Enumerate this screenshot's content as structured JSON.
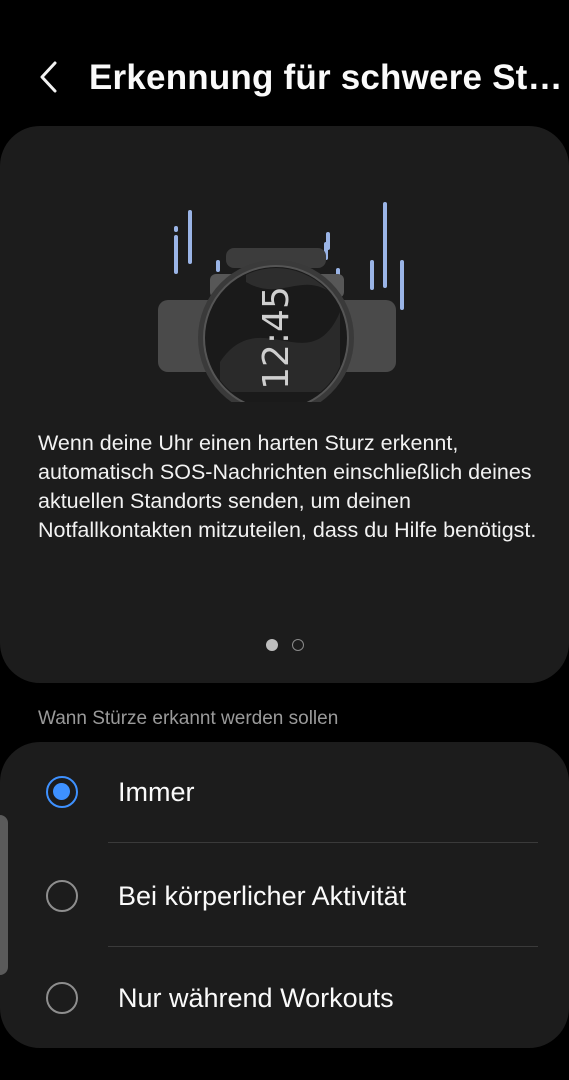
{
  "header": {
    "title": "Erkennung für schwere Stü..."
  },
  "info_card": {
    "watch_time": "12:45",
    "description": "Wenn deine Uhr einen harten Sturz erkennt, automatisch SOS-Nachrichten einschließlich deines aktuellen Standorts senden, um deinen Notfallkontakten mitzuteilen, dass du Hilfe benötigst.",
    "pager": {
      "pages": 2,
      "current": 1
    }
  },
  "section": {
    "label": "Wann Stürze erkannt werden sollen"
  },
  "options": [
    {
      "label": "Immer",
      "selected": true
    },
    {
      "label": "Bei körperlicher Aktivität",
      "selected": false
    },
    {
      "label": "Nur während Workouts",
      "selected": false
    }
  ],
  "colors": {
    "background": "#000000",
    "card": "#1c1c1c",
    "accent": "#3e91ff",
    "secondary_text": "#9a9a9a",
    "fall_lines": "#9ab4e6"
  }
}
